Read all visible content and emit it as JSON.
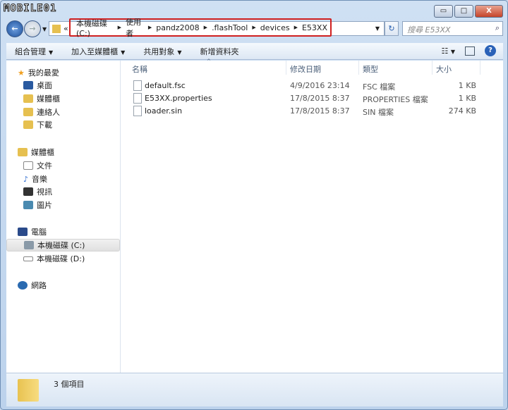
{
  "logo_text": "MOBILE01",
  "window_buttons": {
    "minimize": "▭",
    "maximize": "□",
    "close": "X"
  },
  "breadcrumb": {
    "overflow": "«",
    "items": [
      "本機磁碟 (C:)",
      "使用者",
      "pandz2008",
      ".flashTool",
      "devices",
      "E53XX"
    ]
  },
  "search": {
    "placeholder": "搜尋 E53XX",
    "icon": "search-icon"
  },
  "toolbar": {
    "organize": "組合管理",
    "add_to_library": "加入至媒體櫃",
    "share": "共用對象",
    "new_folder": "新增資料夾"
  },
  "nav": {
    "favorites": {
      "label": "我的最愛",
      "items": [
        "桌面",
        "媒體櫃",
        "連絡人",
        "下載"
      ]
    },
    "libraries": {
      "label": "媒體櫃",
      "items": [
        "文件",
        "音樂",
        "視訊",
        "圖片"
      ]
    },
    "computer": {
      "label": "電腦",
      "items": [
        "本機磁碟 (C:)",
        "本機磁碟 (D:)"
      ]
    },
    "network": {
      "label": "網路"
    }
  },
  "columns": [
    "名稱",
    "修改日期",
    "類型",
    "大小"
  ],
  "files": [
    {
      "name": "default.fsc",
      "date": "4/9/2016 23:14",
      "type": "FSC 檔案",
      "size": "1 KB"
    },
    {
      "name": "E53XX.properties",
      "date": "17/8/2015 8:37",
      "type": "PROPERTIES 檔案",
      "size": "1 KB"
    },
    {
      "name": "loader.sin",
      "date": "17/8/2015 8:37",
      "type": "SIN 檔案",
      "size": "274 KB"
    }
  ],
  "status": {
    "count": "3 個項目"
  }
}
